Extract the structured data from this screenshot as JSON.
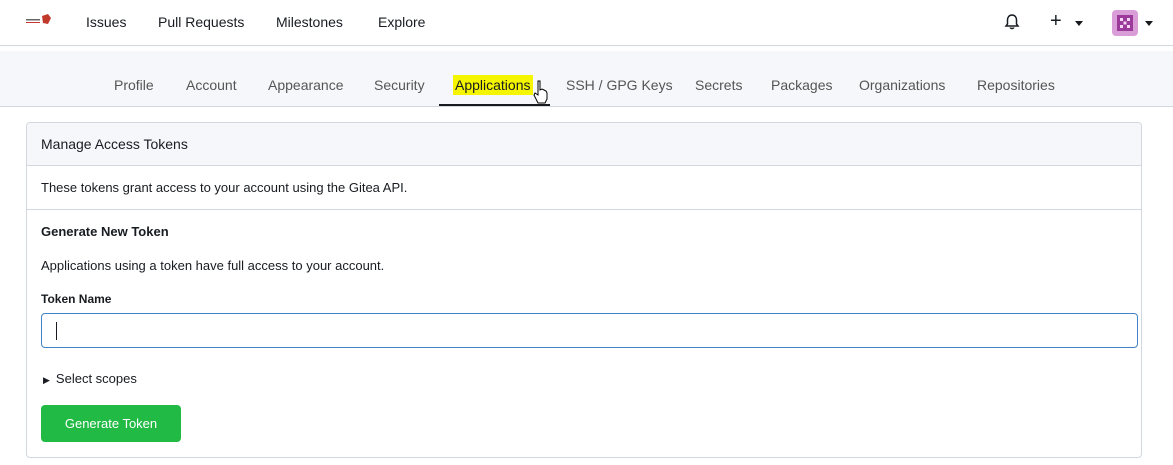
{
  "nav": {
    "items": [
      {
        "label": "Issues"
      },
      {
        "label": "Pull Requests"
      },
      {
        "label": "Milestones"
      },
      {
        "label": "Explore"
      }
    ],
    "icons": [
      "bell-icon",
      "plus-icon",
      "avatar"
    ]
  },
  "tabs": [
    {
      "label": "Profile"
    },
    {
      "label": "Account"
    },
    {
      "label": "Appearance"
    },
    {
      "label": "Security"
    },
    {
      "label": "Applications",
      "active": true
    },
    {
      "label": "SSH / GPG Keys"
    },
    {
      "label": "Secrets"
    },
    {
      "label": "Packages"
    },
    {
      "label": "Organizations"
    },
    {
      "label": "Repositories"
    }
  ],
  "tokens": {
    "header": "Manage Access Tokens",
    "description": "These tokens grant access to your account using the Gitea API.",
    "generate_title": "Generate New Token",
    "generate_description": "Applications using a token have full access to your account.",
    "token_name_label": "Token Name",
    "token_name_value": "",
    "select_scopes": "Select scopes",
    "generate_button": "Generate Token"
  },
  "colors": {
    "accent_green": "#21ba45",
    "highlight": "#f5f500",
    "input_border": "#4183c4"
  }
}
